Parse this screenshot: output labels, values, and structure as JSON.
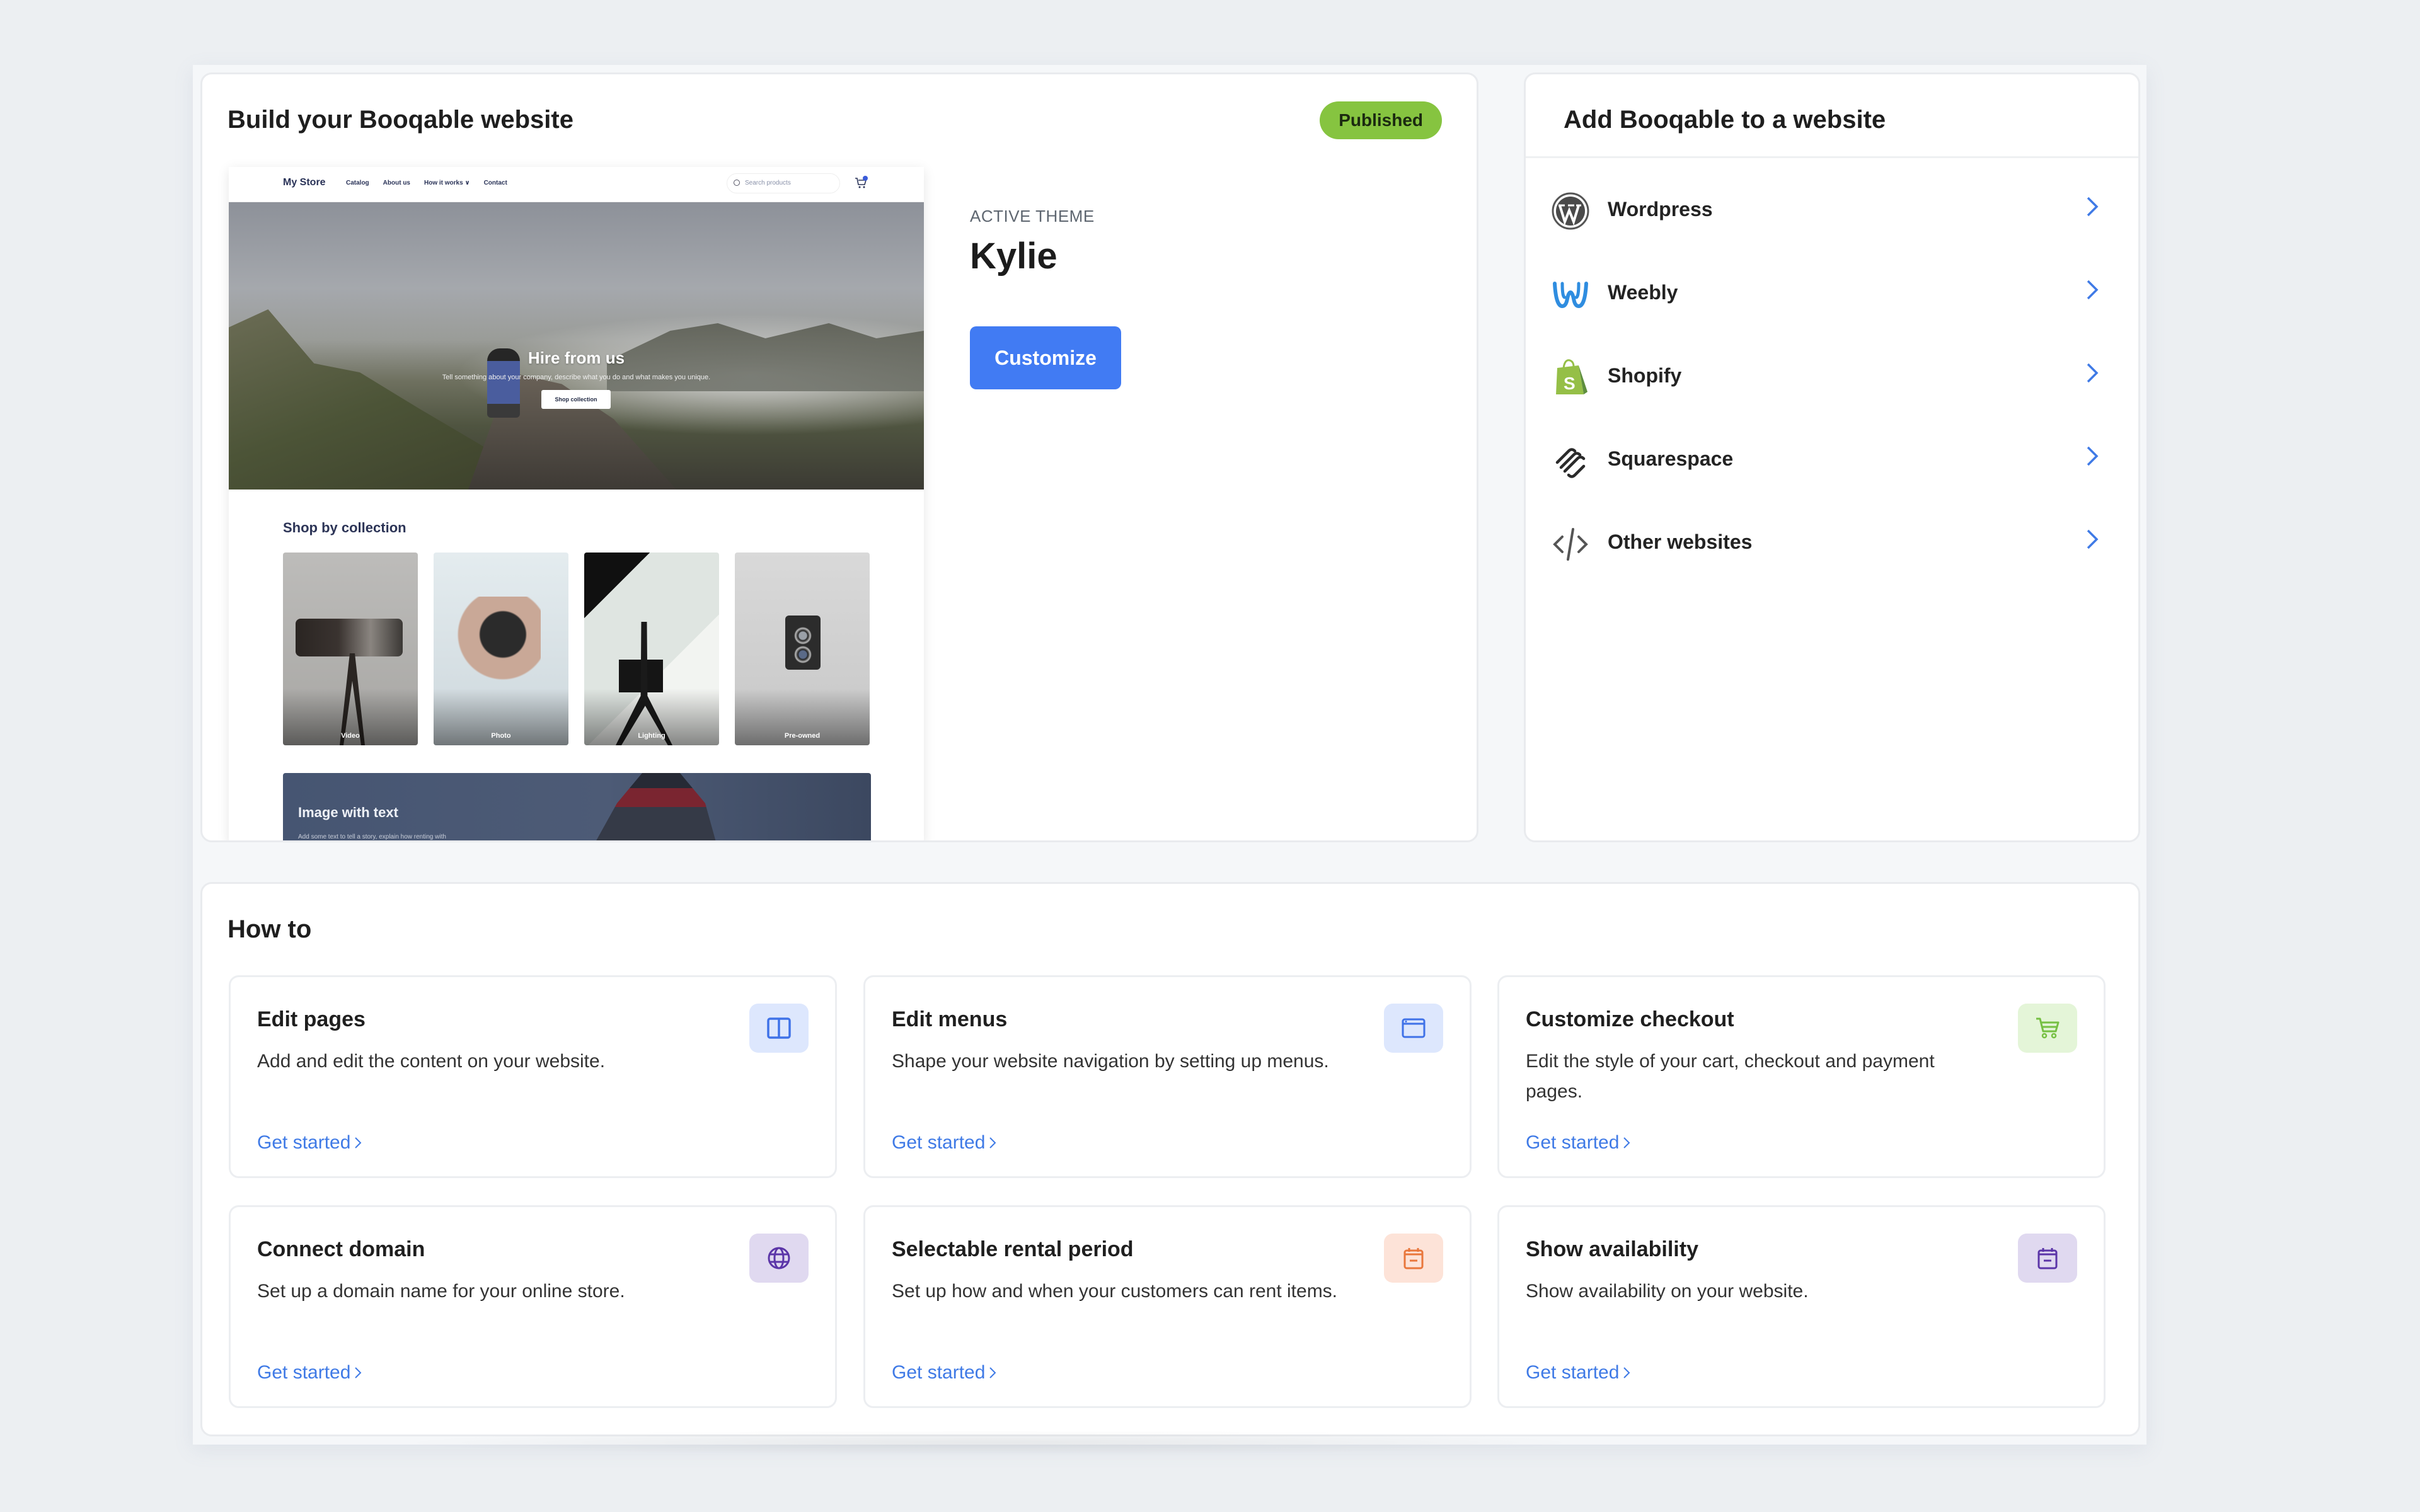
{
  "build": {
    "title": "Build your Booqable website",
    "status_badge": "Published",
    "status_color": "#86c440",
    "active_theme_label": "ACTIVE THEME",
    "theme_name": "Kylie",
    "customize_label": "Customize",
    "accent_color": "#417bf3",
    "preview": {
      "brand": "My Store",
      "nav_links": [
        "Catalog",
        "About us",
        "How it works ∨",
        "Contact"
      ],
      "search_placeholder": "Search products",
      "cart_count": "1",
      "hero_title": "Hire from us",
      "hero_subtitle": "Tell something about your company, describe what you do and what makes you unique.",
      "hero_button": "Shop collection",
      "collection_title": "Shop by collection",
      "collections": [
        "Video",
        "Photo",
        "Lighting",
        "Pre-owned"
      ],
      "image_text_title": "Image with text",
      "image_text_body": "Add some text to tell a story, explain how renting with"
    }
  },
  "add_to_website": {
    "title": "Add Booqable to a website",
    "items": [
      {
        "label": "Wordpress",
        "icon": "wordpress-icon"
      },
      {
        "label": "Weebly",
        "icon": "weebly-icon"
      },
      {
        "label": "Shopify",
        "icon": "shopify-icon"
      },
      {
        "label": "Squarespace",
        "icon": "squarespace-icon"
      },
      {
        "label": "Other websites",
        "icon": "code-icon"
      }
    ]
  },
  "how_to": {
    "title": "How to",
    "tiles": [
      {
        "title": "Edit pages",
        "description": "Add and edit the content on your website.",
        "link": "Get started",
        "icon": "columns-icon",
        "icon_color": "#3f72e8",
        "icon_bg": "#dde7fd"
      },
      {
        "title": "Edit menus",
        "description": "Shape your website navigation by setting up menus.",
        "link": "Get started",
        "icon": "browser-window-icon",
        "icon_color": "#3f72e8",
        "icon_bg": "#dde7fd"
      },
      {
        "title": "Customize checkout",
        "description": "Edit the style of your cart, checkout and payment pages.",
        "link": "Get started",
        "icon": "cart-icon",
        "icon_color": "#76c043",
        "icon_bg": "#e4f5d8"
      },
      {
        "title": "Connect domain",
        "description": "Set up a domain name for your online store.",
        "link": "Get started",
        "icon": "globe-icon",
        "icon_color": "#5b35a8",
        "icon_bg": "#e0d9f0"
      },
      {
        "title": "Selectable rental period",
        "description": "Set up how and when your customers can rent items.",
        "link": "Get started",
        "icon": "calendar-icon",
        "icon_color": "#e9773c",
        "icon_bg": "#fde3d8"
      },
      {
        "title": "Show availability",
        "description": "Show availability on your website.",
        "link": "Get started",
        "icon": "calendar-icon",
        "icon_color": "#5b35a8",
        "icon_bg": "#e0d9f0"
      }
    ]
  }
}
